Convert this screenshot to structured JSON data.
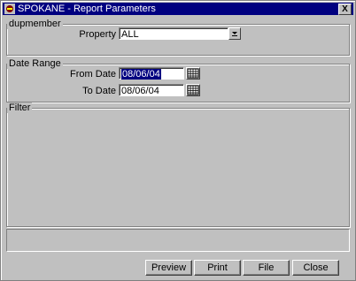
{
  "window": {
    "title": "SPOKANE - Report Parameters",
    "close_glyph": "X"
  },
  "groups": {
    "member": {
      "label": "dupmember",
      "property_label": "Property",
      "property_value": "ALL"
    },
    "date_range": {
      "label": "Date Range",
      "from_label": "From Date",
      "from_value": "08/06/04",
      "to_label": "To Date",
      "to_value": "08/06/04"
    },
    "filter": {
      "label": "Filter"
    }
  },
  "buttons": {
    "preview": "Preview",
    "print": "Print",
    "file": "File",
    "close": "Close"
  },
  "icons": {
    "app": "app-icon",
    "dropdown": "dropdown-arrow-icon",
    "calendar": "calendar-icon"
  }
}
